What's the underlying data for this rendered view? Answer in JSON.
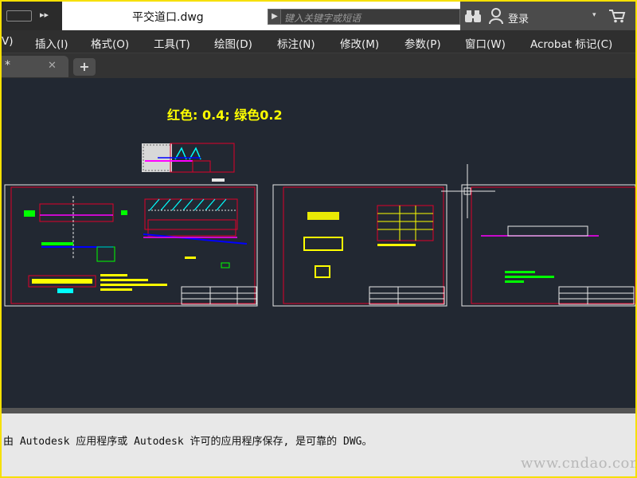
{
  "title_bar": {
    "doc_title": "平交道口.dwg",
    "search_placeholder": "键入关键字或短语",
    "login_label": "登录",
    "caret": "▾"
  },
  "menu": {
    "items": [
      {
        "label": "V)"
      },
      {
        "label": "插入(I)"
      },
      {
        "label": "格式(O)"
      },
      {
        "label": "工具(T)"
      },
      {
        "label": "绘图(D)"
      },
      {
        "label": "标注(N)"
      },
      {
        "label": "修改(M)"
      },
      {
        "label": "参数(P)"
      },
      {
        "label": "窗口(W)"
      },
      {
        "label": "Acrobat 标记(C)"
      }
    ]
  },
  "tabs": {
    "active_tab_label": "*",
    "close_glyph": "✕",
    "add_glyph": "+"
  },
  "drawing": {
    "annotation": "红色: 0.4; 绿色0.2",
    "colors": {
      "background": "#222832",
      "frame_red": "#e0002a",
      "sheet_white": "#e8e8e8",
      "annotation_yellow": "#ffff00",
      "green": "#00ff00",
      "magenta": "#ff00ff",
      "cyan": "#00ffff",
      "blue": "#0000ff"
    }
  },
  "status": {
    "message": "由 Autodesk 应用程序或 Autodesk 许可的应用程序保存, 是可靠的 DWG。",
    "watermark": "www.cndao.com"
  }
}
